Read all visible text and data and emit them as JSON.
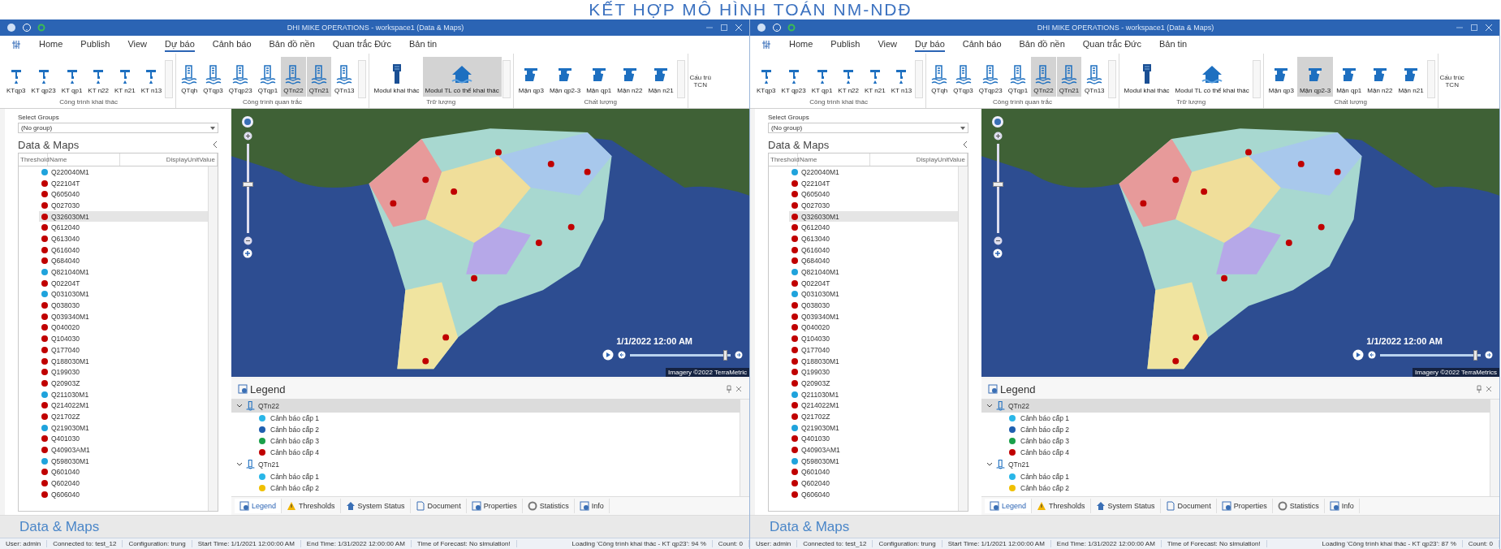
{
  "overlay_title": "KẾT HỢP MÔ HÌNH TOÁN NM-NDĐ",
  "windows": [
    {
      "title": "DHI MIKE OPERATIONS - workspace1 (Data & Maps)",
      "ribbon_tabs": [
        {
          "label": "Home",
          "selected": false
        },
        {
          "label": "Publish",
          "selected": false
        },
        {
          "label": "View",
          "selected": false
        },
        {
          "label": "Dự báo",
          "selected": true
        },
        {
          "label": "Cảnh báo",
          "selected": false
        },
        {
          "label": "Bản đồ nền",
          "selected": false
        },
        {
          "label": "Quan trắc Đức",
          "selected": false
        },
        {
          "label": "Bản tin",
          "selected": false
        }
      ],
      "ribbon_groups": [
        {
          "label": "Công trình khai thác",
          "buttons": [
            {
              "label": "KTqp3",
              "kind": "tap",
              "selected": false
            },
            {
              "label": "KT qp23",
              "kind": "tap",
              "selected": false
            },
            {
              "label": "KT qp1",
              "kind": "tap",
              "selected": false
            },
            {
              "label": "KT n22",
              "kind": "tap",
              "selected": false
            },
            {
              "label": "KT n21",
              "kind": "tap",
              "selected": false
            },
            {
              "label": "KT n13",
              "kind": "tap",
              "selected": false
            }
          ]
        },
        {
          "label": "Công trình quan trắc",
          "buttons": [
            {
              "label": "QTqh",
              "kind": "gauge",
              "selected": false
            },
            {
              "label": "QTqp3",
              "kind": "gauge",
              "selected": false
            },
            {
              "label": "QTqp23",
              "kind": "gauge",
              "selected": false
            },
            {
              "label": "QTqp1",
              "kind": "gauge",
              "selected": false
            },
            {
              "label": "QTn22",
              "kind": "gauge",
              "selected": true
            },
            {
              "label": "QTn21",
              "kind": "gauge",
              "selected": true
            },
            {
              "label": "QTn13",
              "kind": "gauge",
              "selected": false
            }
          ]
        },
        {
          "label": "Trữ lượng",
          "buttons": [
            {
              "label": "Modul khai thác",
              "kind": "tower",
              "selected": false
            },
            {
              "label": "Modul TL có thể khai thác",
              "kind": "house",
              "selected": true
            }
          ]
        },
        {
          "label": "Chất lượng",
          "buttons": [
            {
              "label": "Mặn qp3",
              "kind": "salt",
              "selected": false
            },
            {
              "label": "Mặn qp2-3",
              "kind": "salt",
              "selected": false
            },
            {
              "label": "Mặn qp1",
              "kind": "salt",
              "selected": false
            },
            {
              "label": "Mặn n22",
              "kind": "salt",
              "selected": false
            },
            {
              "label": "Mặn n21",
              "kind": "salt",
              "selected": false
            }
          ]
        }
      ],
      "overflow": {
        "label": "Cấu trú",
        "sub": "TCN"
      },
      "panel": {
        "select_label": "Select Groups",
        "group_value": "(No group)",
        "title": "Data & Maps",
        "columns": [
          "Threshold",
          "Name",
          "DisplayUnitValue"
        ],
        "rows": [
          {
            "name": "Q220040M1",
            "color": "#1fa3dc",
            "selected": false
          },
          {
            "name": "Q22104T",
            "color": "#c00000",
            "selected": false
          },
          {
            "name": "Q605040",
            "color": "#c00000",
            "selected": false
          },
          {
            "name": "Q027030",
            "color": "#c00000",
            "selected": false
          },
          {
            "name": "Q326030M1",
            "color": "#c00000",
            "selected": true
          },
          {
            "name": "Q612040",
            "color": "#c00000",
            "selected": false
          },
          {
            "name": "Q613040",
            "color": "#c00000",
            "selected": false
          },
          {
            "name": "Q616040",
            "color": "#c00000",
            "selected": false
          },
          {
            "name": "Q684040",
            "color": "#c00000",
            "selected": false
          },
          {
            "name": "Q821040M1",
            "color": "#1fa3dc",
            "selected": false
          },
          {
            "name": "Q02204T",
            "color": "#c00000",
            "selected": false
          },
          {
            "name": "Q031030M1",
            "color": "#1fa3dc",
            "selected": false
          },
          {
            "name": "Q038030",
            "color": "#c00000",
            "selected": false
          },
          {
            "name": "Q039340M1",
            "color": "#c00000",
            "selected": false
          },
          {
            "name": "Q040020",
            "color": "#c00000",
            "selected": false
          },
          {
            "name": "Q104030",
            "color": "#c00000",
            "selected": false
          },
          {
            "name": "Q177040",
            "color": "#c00000",
            "selected": false
          },
          {
            "name": "Q188030M1",
            "color": "#c00000",
            "selected": false
          },
          {
            "name": "Q199030",
            "color": "#c00000",
            "selected": false
          },
          {
            "name": "Q20903Z",
            "color": "#c00000",
            "selected": false
          },
          {
            "name": "Q211030M1",
            "color": "#1fa3dc",
            "selected": false
          },
          {
            "name": "Q214022M1",
            "color": "#c00000",
            "selected": false
          },
          {
            "name": "Q21702Z",
            "color": "#c00000",
            "selected": false
          },
          {
            "name": "Q219030M1",
            "color": "#1fa3dc",
            "selected": false
          },
          {
            "name": "Q401030",
            "color": "#c00000",
            "selected": false
          },
          {
            "name": "Q40903AM1",
            "color": "#c00000",
            "selected": false
          },
          {
            "name": "Q598030M1",
            "color": "#1fa3dc",
            "selected": false
          },
          {
            "name": "Q601040",
            "color": "#c00000",
            "selected": false
          },
          {
            "name": "Q602040",
            "color": "#c00000",
            "selected": false
          },
          {
            "name": "Q606040",
            "color": "#c00000",
            "selected": false
          }
        ]
      },
      "map": {
        "time": "1/1/2022 12:00 AM",
        "attribution": "Imagery ©2022 TerraMetric",
        "zoom_slider": {
          "level": 0.55
        },
        "timeline": {
          "level": 0.97
        }
      },
      "legend": {
        "title": "Legend",
        "groups": [
          {
            "label": "QTn22",
            "expanded": true,
            "selected": true,
            "children": [
              {
                "label": "Cảnh báo cấp 1",
                "color": "#29b6e8"
              },
              {
                "label": "Cảnh báo cấp 2",
                "color": "#1f5fb0"
              },
              {
                "label": "Cảnh báo cấp 3",
                "color": "#1aa04a"
              },
              {
                "label": "Cảnh báo cấp 4",
                "color": "#c00000"
              }
            ]
          },
          {
            "label": "QTn21",
            "expanded": true,
            "selected": false,
            "children": [
              {
                "label": "Cảnh báo cấp 1",
                "color": "#29b6e8"
              },
              {
                "label": "Cảnh báo cấp 2",
                "color": "#f0c000"
              }
            ]
          }
        ]
      },
      "bottom_tabs": [
        {
          "label": "Legend",
          "kind": "legend",
          "selected": true
        },
        {
          "label": "Thresholds",
          "kind": "warning",
          "selected": false
        },
        {
          "label": "System Status",
          "kind": "status",
          "selected": false
        },
        {
          "label": "Document",
          "kind": "document",
          "selected": false
        },
        {
          "label": "Properties",
          "kind": "legend",
          "selected": false
        },
        {
          "label": "Statistics",
          "kind": "stats",
          "selected": false
        },
        {
          "label": "Info",
          "kind": "legend",
          "selected": false
        }
      ],
      "footer_title": "Data & Maps",
      "status_left": [
        "User: admin",
        "Connected to: test_12",
        "Configuration: trung",
        "Start Time: 1/1/2021 12:00:00 AM",
        "End Time: 1/31/2022 12:00:00 AM",
        "Time of Forecast: No simulation!"
      ],
      "status_right": [
        "Loading 'Công trình khai thác - KT qp23': 94 %",
        "Count: 0"
      ]
    },
    {
      "title": "DHI MIKE OPERATIONS - workspace1 (Data & Maps)",
      "ribbon_tabs": [
        {
          "label": "Home",
          "selected": false
        },
        {
          "label": "Publish",
          "selected": false
        },
        {
          "label": "View",
          "selected": false
        },
        {
          "label": "Dự báo",
          "selected": true
        },
        {
          "label": "Cảnh báo",
          "selected": false
        },
        {
          "label": "Bản đồ nền",
          "selected": false
        },
        {
          "label": "Quan trắc Đức",
          "selected": false
        },
        {
          "label": "Bản tin",
          "selected": false
        }
      ],
      "ribbon_groups": [
        {
          "label": "Công trình khai thác",
          "buttons": [
            {
              "label": "KTqp3",
              "kind": "tap",
              "selected": false
            },
            {
              "label": "KT qp23",
              "kind": "tap",
              "selected": false
            },
            {
              "label": "KT qp1",
              "kind": "tap",
              "selected": false
            },
            {
              "label": "KT n22",
              "kind": "tap",
              "selected": false
            },
            {
              "label": "KT n21",
              "kind": "tap",
              "selected": false
            },
            {
              "label": "KT n13",
              "kind": "tap",
              "selected": false
            }
          ]
        },
        {
          "label": "Công trình quan trắc",
          "buttons": [
            {
              "label": "QTqh",
              "kind": "gauge",
              "selected": false
            },
            {
              "label": "QTqp3",
              "kind": "gauge",
              "selected": false
            },
            {
              "label": "QTqp23",
              "kind": "gauge",
              "selected": false
            },
            {
              "label": "QTqp1",
              "kind": "gauge",
              "selected": false
            },
            {
              "label": "QTn22",
              "kind": "gauge",
              "selected": true
            },
            {
              "label": "QTn21",
              "kind": "gauge",
              "selected": true
            },
            {
              "label": "QTn13",
              "kind": "gauge",
              "selected": false
            }
          ]
        },
        {
          "label": "Trữ lượng",
          "buttons": [
            {
              "label": "Modul khai thác",
              "kind": "tower",
              "selected": false
            },
            {
              "label": "Modul TL có thể khai thác",
              "kind": "house",
              "selected": false
            }
          ]
        },
        {
          "label": "Chất lượng",
          "buttons": [
            {
              "label": "Mặn qp3",
              "kind": "salt",
              "selected": false
            },
            {
              "label": "Mặn qp2-3",
              "kind": "salt",
              "selected": true
            },
            {
              "label": "Mặn qp1",
              "kind": "salt",
              "selected": false
            },
            {
              "label": "Mặn n22",
              "kind": "salt",
              "selected": false
            },
            {
              "label": "Mặn n21",
              "kind": "salt",
              "selected": false
            }
          ]
        }
      ],
      "overflow": {
        "label": "Cấu trúc",
        "sub": "TCN"
      },
      "panel": {
        "select_label": "Select Groups",
        "group_value": "(No group)",
        "title": "Data & Maps",
        "columns": [
          "Threshold",
          "Name",
          "DisplayUnitValue"
        ],
        "rows": [
          {
            "name": "Q220040M1",
            "color": "#1fa3dc",
            "selected": false
          },
          {
            "name": "Q22104T",
            "color": "#c00000",
            "selected": false
          },
          {
            "name": "Q605040",
            "color": "#c00000",
            "selected": false
          },
          {
            "name": "Q027030",
            "color": "#c00000",
            "selected": false
          },
          {
            "name": "Q326030M1",
            "color": "#c00000",
            "selected": true
          },
          {
            "name": "Q612040",
            "color": "#c00000",
            "selected": false
          },
          {
            "name": "Q613040",
            "color": "#c00000",
            "selected": false
          },
          {
            "name": "Q616040",
            "color": "#c00000",
            "selected": false
          },
          {
            "name": "Q684040",
            "color": "#c00000",
            "selected": false
          },
          {
            "name": "Q821040M1",
            "color": "#1fa3dc",
            "selected": false
          },
          {
            "name": "Q02204T",
            "color": "#c00000",
            "selected": false
          },
          {
            "name": "Q031030M1",
            "color": "#1fa3dc",
            "selected": false
          },
          {
            "name": "Q038030",
            "color": "#c00000",
            "selected": false
          },
          {
            "name": "Q039340M1",
            "color": "#c00000",
            "selected": false
          },
          {
            "name": "Q040020",
            "color": "#c00000",
            "selected": false
          },
          {
            "name": "Q104030",
            "color": "#c00000",
            "selected": false
          },
          {
            "name": "Q177040",
            "color": "#c00000",
            "selected": false
          },
          {
            "name": "Q188030M1",
            "color": "#c00000",
            "selected": false
          },
          {
            "name": "Q199030",
            "color": "#c00000",
            "selected": false
          },
          {
            "name": "Q20903Z",
            "color": "#c00000",
            "selected": false
          },
          {
            "name": "Q211030M1",
            "color": "#1fa3dc",
            "selected": false
          },
          {
            "name": "Q214022M1",
            "color": "#c00000",
            "selected": false
          },
          {
            "name": "Q21702Z",
            "color": "#c00000",
            "selected": false
          },
          {
            "name": "Q219030M1",
            "color": "#1fa3dc",
            "selected": false
          },
          {
            "name": "Q401030",
            "color": "#c00000",
            "selected": false
          },
          {
            "name": "Q40903AM1",
            "color": "#c00000",
            "selected": false
          },
          {
            "name": "Q598030M1",
            "color": "#1fa3dc",
            "selected": false
          },
          {
            "name": "Q601040",
            "color": "#c00000",
            "selected": false
          },
          {
            "name": "Q602040",
            "color": "#c00000",
            "selected": false
          },
          {
            "name": "Q606040",
            "color": "#c00000",
            "selected": false
          }
        ]
      },
      "map": {
        "time": "1/1/2022 12:00 AM",
        "attribution": "Imagery ©2022 TerraMetrics",
        "zoom_slider": {
          "level": 0.55
        },
        "timeline": {
          "level": 0.97
        }
      },
      "legend": {
        "title": "Legend",
        "groups": [
          {
            "label": "QTn22",
            "expanded": true,
            "selected": true,
            "children": [
              {
                "label": "Cảnh báo cấp 1",
                "color": "#29b6e8"
              },
              {
                "label": "Cảnh báo cấp 2",
                "color": "#1f5fb0"
              },
              {
                "label": "Cảnh báo cấp 3",
                "color": "#1aa04a"
              },
              {
                "label": "Cảnh báo cấp 4",
                "color": "#c00000"
              }
            ]
          },
          {
            "label": "QTn21",
            "expanded": true,
            "selected": false,
            "children": [
              {
                "label": "Cảnh báo cấp 1",
                "color": "#29b6e8"
              },
              {
                "label": "Cảnh báo cấp 2",
                "color": "#f0c000"
              }
            ]
          }
        ]
      },
      "bottom_tabs": [
        {
          "label": "Legend",
          "kind": "legend",
          "selected": true
        },
        {
          "label": "Thresholds",
          "kind": "warning",
          "selected": false
        },
        {
          "label": "System Status",
          "kind": "status",
          "selected": false
        },
        {
          "label": "Document",
          "kind": "document",
          "selected": false
        },
        {
          "label": "Properties",
          "kind": "legend",
          "selected": false
        },
        {
          "label": "Statistics",
          "kind": "stats",
          "selected": false
        },
        {
          "label": "Info",
          "kind": "legend",
          "selected": false
        }
      ],
      "footer_title": "Data & Maps",
      "status_left": [
        "User: admin",
        "Connected to: test_12",
        "Configuration: trung",
        "Start Time: 1/1/2021 12:00:00 AM",
        "End Time: 1/31/2022 12:00:00 AM",
        "Time of Forecast: No simulation!"
      ],
      "status_right": [
        "Loading 'Công trình khai thác - KT qp23': 87 %",
        "Count: 0"
      ]
    }
  ]
}
